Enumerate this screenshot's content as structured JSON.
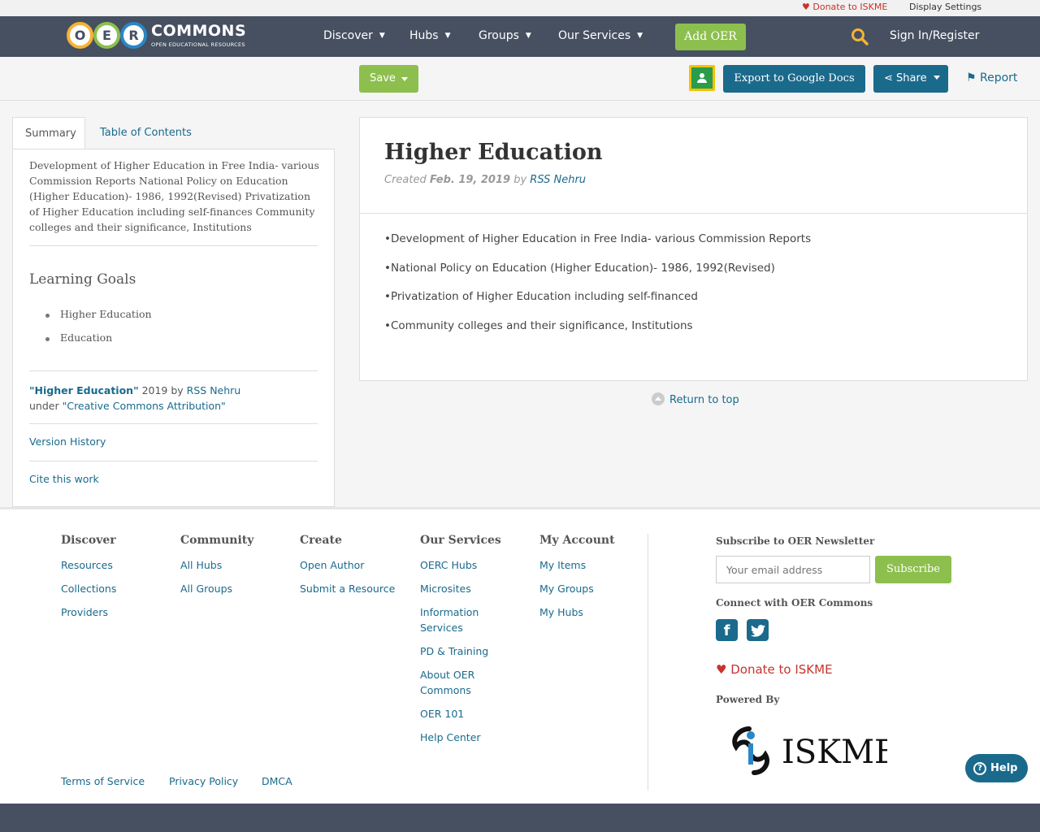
{
  "util_bar": {
    "donate_label": "Donate to ISKME",
    "display_settings_label": "Display Settings"
  },
  "brand": {
    "letters": [
      "O",
      "E",
      "R"
    ],
    "wordmark": "COMMONS",
    "tagline": "OPEN EDUCATIONAL RESOURCES",
    "colors": [
      "#f5b335",
      "#8dbf4e",
      "#2a86c6"
    ]
  },
  "nav": {
    "items": [
      "Discover",
      "Hubs",
      "Groups",
      "Our Services"
    ],
    "add_oer_label": "Add OER",
    "signin_label": "Sign In/Register"
  },
  "toolbar": {
    "save_label": "Save",
    "export_label": "Export to Google Docs",
    "share_label": "Share",
    "report_label": "Report"
  },
  "left_panel": {
    "tabs": [
      "Summary",
      "Table of Contents"
    ],
    "summary": "Development of Higher Education in Free India- various Commission Reports National Policy on Education (Higher Education)- 1986, 1992(Revised) Privatization of Higher Education including self-finances Community colleges and their significance, Institutions",
    "learning_goals_title": "Learning Goals",
    "learning_goals": [
      "Higher Education",
      "Education"
    ],
    "attribution": {
      "title": "\"Higher Education\"",
      "year_by": " 2019 by ",
      "author": "RSS Nehru",
      "under": "under ",
      "license": "\"Creative Commons Attribution\""
    },
    "version_history_label": "Version History",
    "cite_label": "Cite this work"
  },
  "main": {
    "title": "Higher Education",
    "created_prefix": "Created ",
    "created_date": "Feb. 19, 2019",
    "by": " by ",
    "author": "RSS Nehru",
    "bullets": [
      "•Development of Higher Education in Free India- various Commission Reports",
      "•National Policy on Education (Higher Education)- 1986, 1992(Revised)",
      "•Privatization of Higher Education including self-financed",
      "•Community colleges and their significance, Institutions"
    ],
    "return_top_label": "Return to top"
  },
  "footer": {
    "columns": [
      {
        "title": "Discover",
        "links": [
          "Resources",
          "Collections",
          "Providers"
        ]
      },
      {
        "title": "Community",
        "links": [
          "All Hubs",
          "All Groups"
        ]
      },
      {
        "title": "Create",
        "links": [
          "Open Author",
          "Submit a Resource"
        ]
      },
      {
        "title": "Our Services",
        "links": [
          "OERC Hubs",
          "Microsites",
          "Information Services",
          "PD & Training",
          "About OER Commons",
          "OER 101",
          "Help Center"
        ]
      },
      {
        "title": "My Account",
        "links": [
          "My Items",
          "My Groups",
          "My Hubs"
        ]
      }
    ],
    "newsletter_title": "Subscribe to OER Newsletter",
    "email_placeholder": "Your email address",
    "subscribe_label": "Subscribe",
    "connect_title": "Connect with OER Commons",
    "donate_label": "Donate to ISKME",
    "powered_by": "Powered By",
    "iskme_logo_text": "ISKME",
    "legal_links": [
      "Terms of Service",
      "Privacy Policy",
      "DMCA"
    ]
  },
  "help_label": "Help",
  "colors": {
    "nav_bg": "#465061",
    "accent_green": "#8dbf4e",
    "link_blue": "#1a6a8c",
    "donate_red": "#c8332c"
  }
}
